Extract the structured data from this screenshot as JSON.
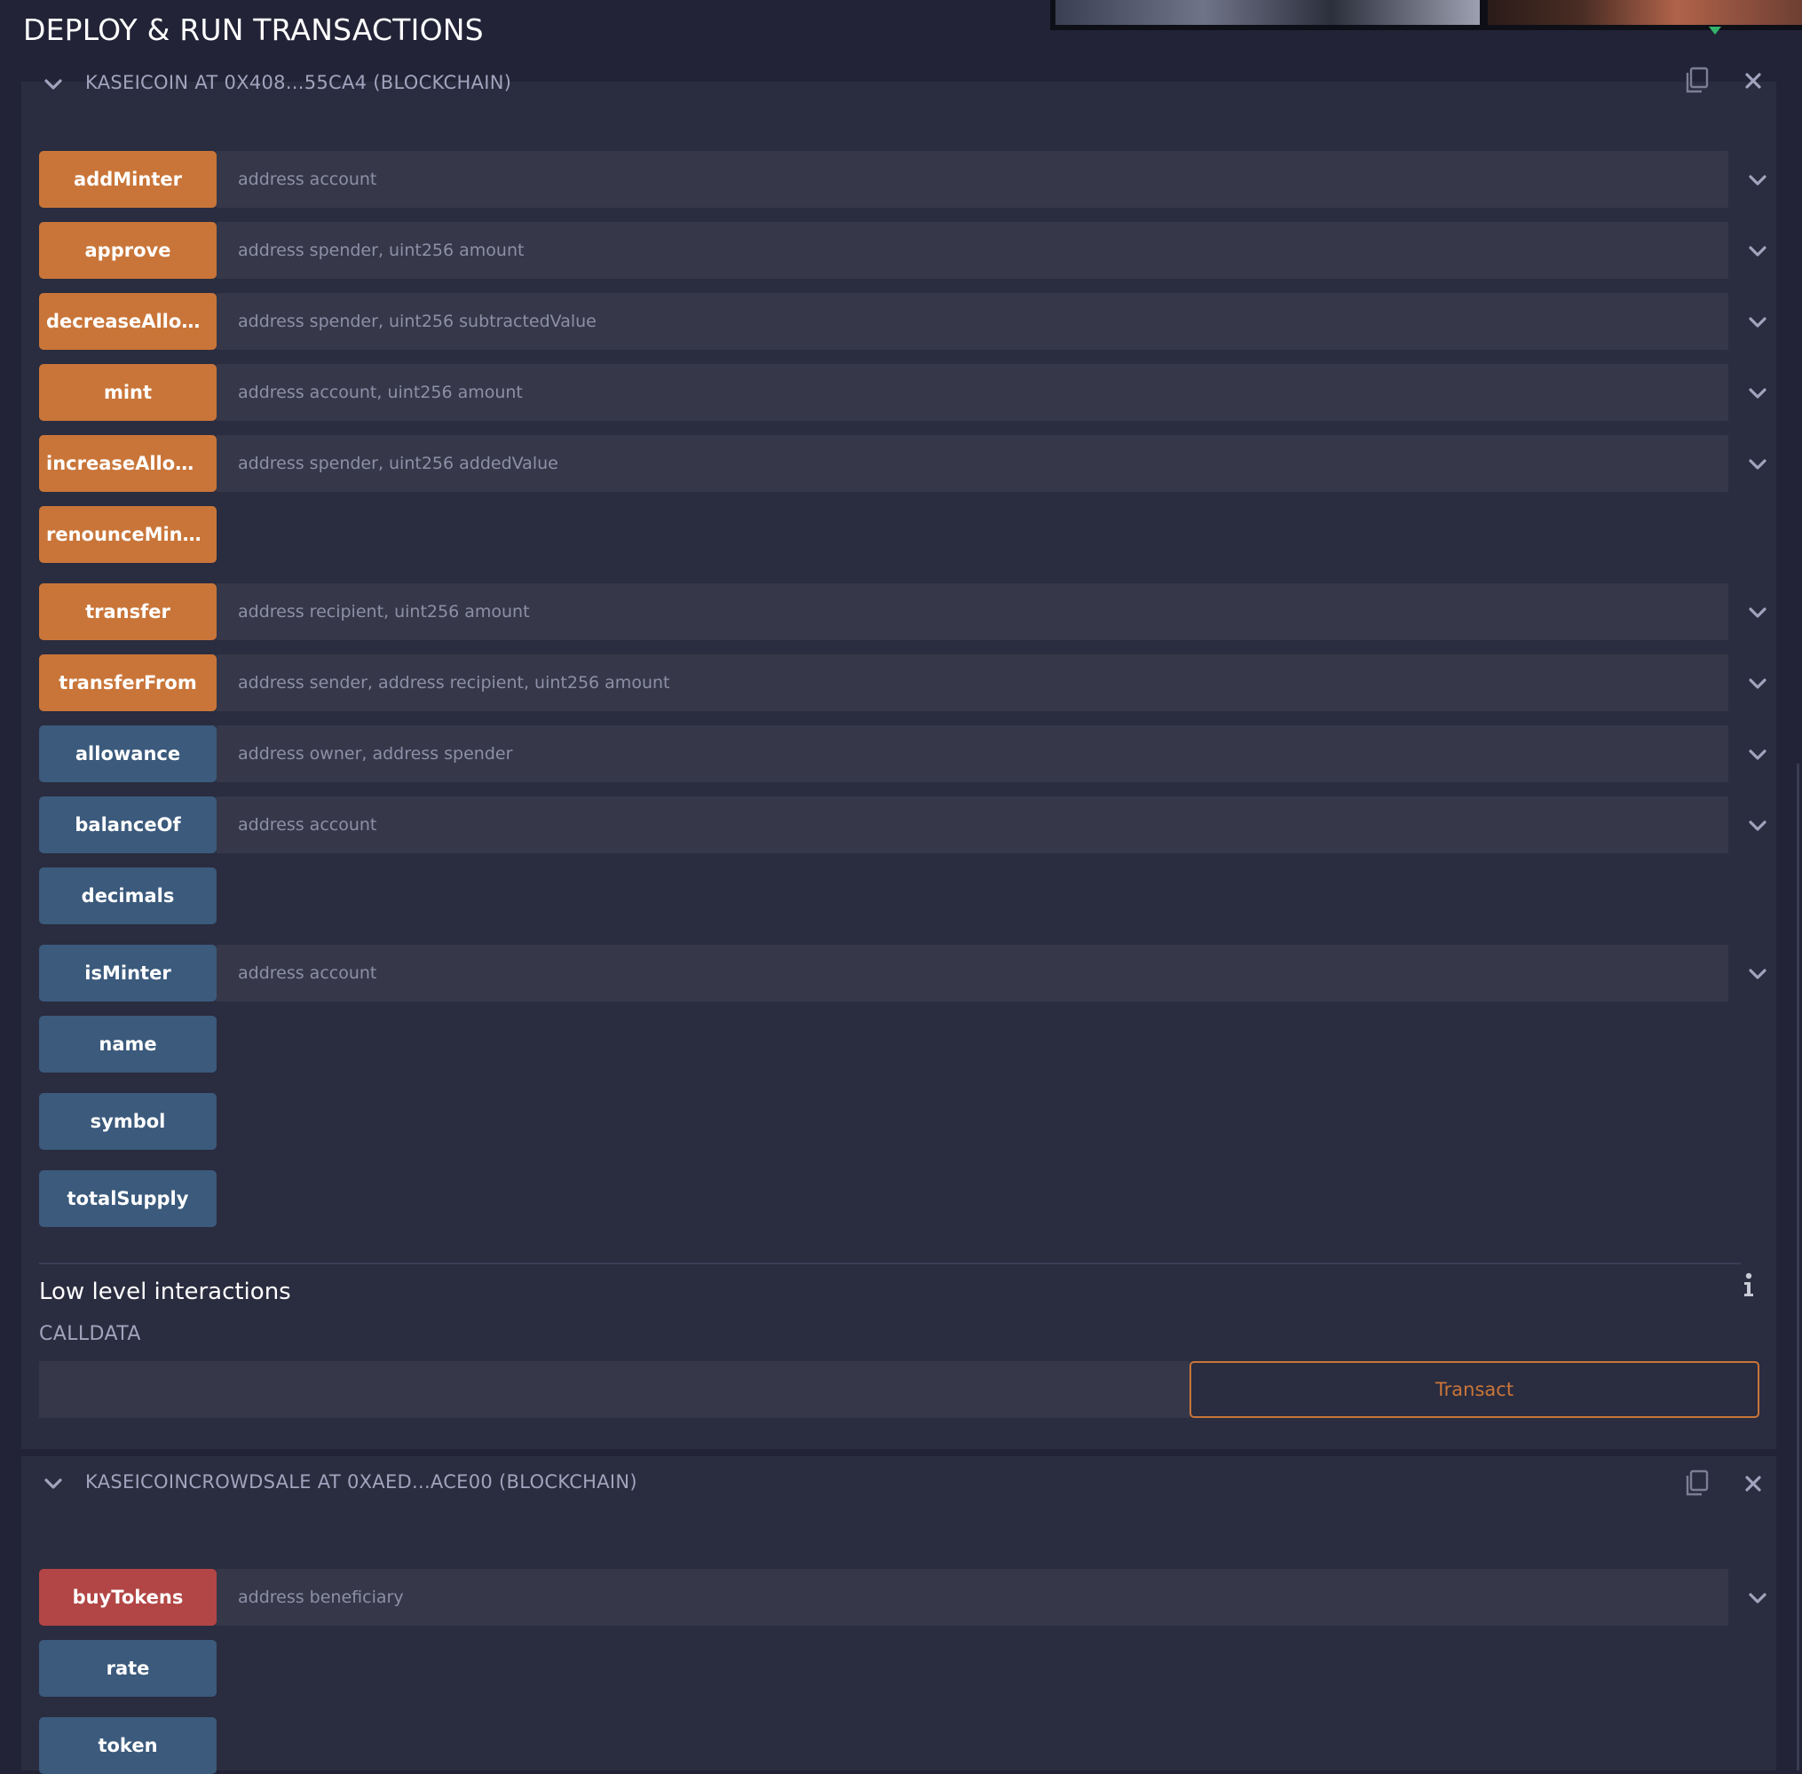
{
  "panel": {
    "title": "DEPLOY & RUN TRANSACTIONS"
  },
  "colors": {
    "background": "#222336",
    "instance_bg": "#2a2c3f",
    "transact_button": "#c97539",
    "call_button": "#3b5a7c",
    "payable_button": "#b24545",
    "input_bg": "#363849"
  },
  "instances": [
    {
      "title": "KASEICOIN AT 0X408...55CA4 (BLOCKCHAIN)",
      "functions": [
        {
          "label": "addMinter",
          "kind": "transact",
          "params": "address account"
        },
        {
          "label": "approve",
          "kind": "transact",
          "params": "address spender, uint256 amount"
        },
        {
          "label": "decreaseAllow...",
          "kind": "transact",
          "params": "address spender, uint256 subtractedValue"
        },
        {
          "label": "mint",
          "kind": "transact",
          "params": "address account, uint256 amount"
        },
        {
          "label": "increaseAllow...",
          "kind": "transact",
          "params": "address spender, uint256 addedValue"
        },
        {
          "label": "renounceMinter",
          "kind": "transact",
          "params": ""
        },
        {
          "label": "transfer",
          "kind": "transact",
          "params": "address recipient, uint256 amount"
        },
        {
          "label": "transferFrom",
          "kind": "transact",
          "params": "address sender, address recipient, uint256 amount"
        },
        {
          "label": "allowance",
          "kind": "call",
          "params": "address owner, address spender"
        },
        {
          "label": "balanceOf",
          "kind": "call",
          "params": "address account"
        },
        {
          "label": "decimals",
          "kind": "call",
          "params": ""
        },
        {
          "label": "isMinter",
          "kind": "call",
          "params": "address account"
        },
        {
          "label": "name",
          "kind": "call",
          "params": ""
        },
        {
          "label": "symbol",
          "kind": "call",
          "params": ""
        },
        {
          "label": "totalSupply",
          "kind": "call",
          "params": ""
        }
      ],
      "low_level": {
        "heading": "Low level interactions",
        "calldata_label": "CALLDATA",
        "calldata_value": "",
        "transact_label": "Transact"
      }
    },
    {
      "title": "KASEICOINCROWDSALE AT 0XAED...ACE00 (BLOCKCHAIN)",
      "functions": [
        {
          "label": "buyTokens",
          "kind": "payable",
          "params": "address beneficiary"
        },
        {
          "label": "rate",
          "kind": "call",
          "params": ""
        },
        {
          "label": "token",
          "kind": "call",
          "params": ""
        }
      ]
    }
  ],
  "icons": {
    "caret": "chevron-down-icon",
    "copy": "copy-icon",
    "close": "close-icon",
    "expand": "chevron-down-icon",
    "info": "info-icon"
  }
}
